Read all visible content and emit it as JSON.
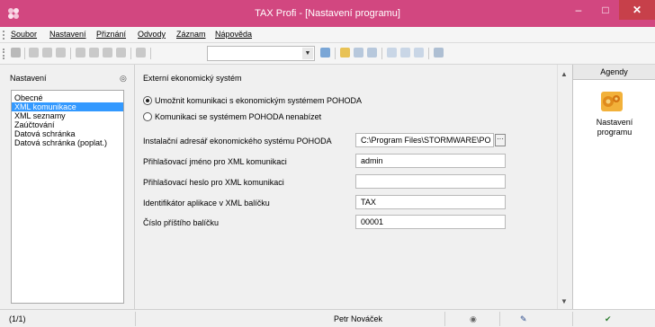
{
  "window": {
    "title": "TAX Profi - [Nastavení programu]",
    "min_glyph": "–",
    "max_glyph": "□",
    "close_glyph": "✕"
  },
  "menu": {
    "items": [
      "Soubor",
      "Nastavení",
      "Přiznání",
      "Odvody",
      "Záznam",
      "Nápověda"
    ]
  },
  "left_panel": {
    "title": "Nastavení",
    "items": [
      {
        "label": "Obecné",
        "selected": false
      },
      {
        "label": "XML komunikace",
        "selected": true
      },
      {
        "label": "XML seznamy",
        "selected": false
      },
      {
        "label": "Zaúčtování",
        "selected": false
      },
      {
        "label": "Datová schránka",
        "selected": false
      },
      {
        "label": "Datová schránka (poplat.)",
        "selected": false
      }
    ]
  },
  "main": {
    "section_title": "Externí ekonomický systém",
    "radio_enable": "Umožnit komunikaci s ekonomickým systémem POHODA",
    "radio_disable": "Komunikaci se systémem POHODA nenabízet",
    "selected_radio": "enable",
    "fields": {
      "install_dir": {
        "label": "Instalační adresář ekonomického systému POHODA",
        "value": "C:\\Program Files\\STORMWARE\\PO"
      },
      "login_name": {
        "label": "Přihlašovací jméno pro XML komunikaci",
        "value": "admin"
      },
      "login_password": {
        "label": "Přihlašovací heslo pro XML komunikaci",
        "value": ""
      },
      "app_id": {
        "label": "Identifikátor aplikace v XML balíčku",
        "value": "TAX"
      },
      "next_package": {
        "label": "Číslo příštího balíčku",
        "value": "00001"
      }
    },
    "browse_label": "···"
  },
  "agenda": {
    "header": "Agendy",
    "item_label_line1": "Nastavení",
    "item_label_line2": "programu"
  },
  "status": {
    "page": "(1/1)",
    "user": "Petr Nováček"
  },
  "colors": {
    "titlebar": "#d24780",
    "selection": "#3399ff",
    "close_button": "#c7404a"
  }
}
